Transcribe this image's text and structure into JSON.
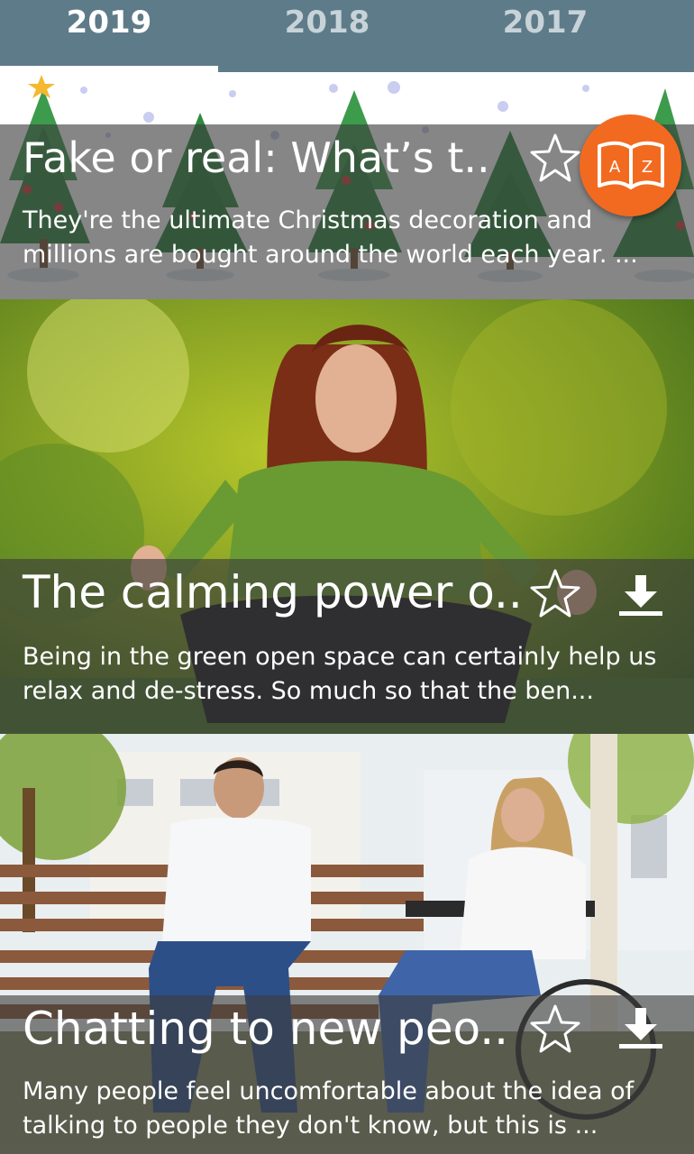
{
  "tabs": [
    {
      "label": "2019",
      "active": true
    },
    {
      "label": "2018",
      "active": false
    },
    {
      "label": "2017",
      "active": false
    }
  ],
  "articles": [
    {
      "title": "Fake or real: What’s t..",
      "description": "They're the ultimate Christmas decoration and millions are bought around the world each year. ...",
      "image": "christmas-trees-illustration",
      "favorite": false
    },
    {
      "title": "The calming power o..",
      "description": "Being in the green open space can certainly help us relax and de-stress. So much so that the ben...",
      "image": "woman-meditating-in-park-photo",
      "favorite": false
    },
    {
      "title": "Chatting to new peo..",
      "description": "Many people feel uncomfortable about the idea of talking to people they don't know, but this is ...",
      "image": "man-on-bench-talking-to-woman-in-wheelchair-photo",
      "favorite": false
    }
  ],
  "fab": {
    "icon": "dictionary-book-icon",
    "left_letter": "A",
    "right_letter": "Z"
  },
  "colors": {
    "tabbar": "#5e7b89",
    "fab": "#f26a20",
    "overlay": "rgba(60,60,60,0.62)"
  }
}
